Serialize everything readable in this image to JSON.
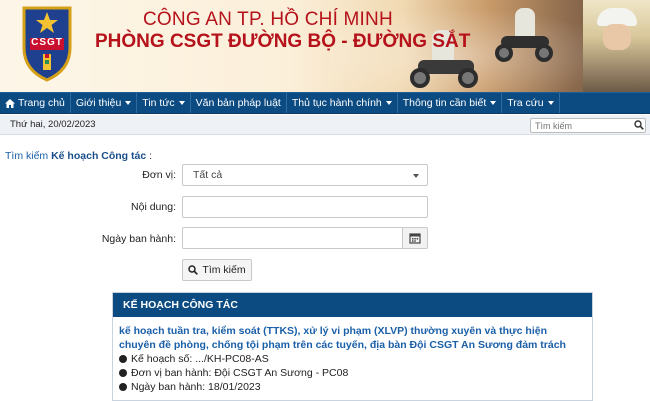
{
  "header": {
    "logo_text": "CSGT",
    "title_line1": "CÔNG AN TP. HỒ CHÍ MINH",
    "title_line2": "PHÒNG CSGT ĐƯỜNG BỘ - ĐƯỜNG SẮT",
    "brand_color": "#b5121b"
  },
  "nav": {
    "items": [
      {
        "label": "Trang chủ",
        "icon": "home-icon",
        "dropdown": false
      },
      {
        "label": "Giới thiệu",
        "dropdown": true
      },
      {
        "label": "Tin tức",
        "dropdown": true
      },
      {
        "label": "Văn bản pháp luật",
        "dropdown": false
      },
      {
        "label": "Thủ tục hành chính",
        "dropdown": true
      },
      {
        "label": "Thông tin cần biết",
        "dropdown": true
      },
      {
        "label": "Tra cứu",
        "dropdown": true
      }
    ],
    "bg_color": "#0c4b82"
  },
  "topbar": {
    "date": "Thứ hai, 20/02/2023",
    "search_placeholder": "Tìm kiếm"
  },
  "breadcrumb": {
    "prefix": "Tìm kiếm",
    "current": "Kế hoạch Công tác",
    "suffix": ":"
  },
  "form": {
    "unit_label": "Đơn vị:",
    "unit_value": "Tất cả",
    "content_label": "Nội dung:",
    "content_value": "",
    "date_label": "Ngày ban hành:",
    "date_value": "",
    "submit_label": "Tìm kiếm"
  },
  "results": {
    "heading": "KẾ HOẠCH CÔNG TÁC",
    "items": [
      {
        "title": "kế hoạch tuần tra, kiểm soát (TTKS), xử lý vi phạm (XLVP) thường xuyên và thực hiện chuyên đề phòng, chống tội phạm trên các tuyến, địa bàn Đội CSGT An Sương đảm trách",
        "plan_no": "Kế hoạch số: .../KH-PC08-AS",
        "issuer": "Đơn vị ban hành: Đội CSGT An Sương - PC08",
        "issued_date": "Ngày ban hành: 18/01/2023"
      }
    ]
  }
}
